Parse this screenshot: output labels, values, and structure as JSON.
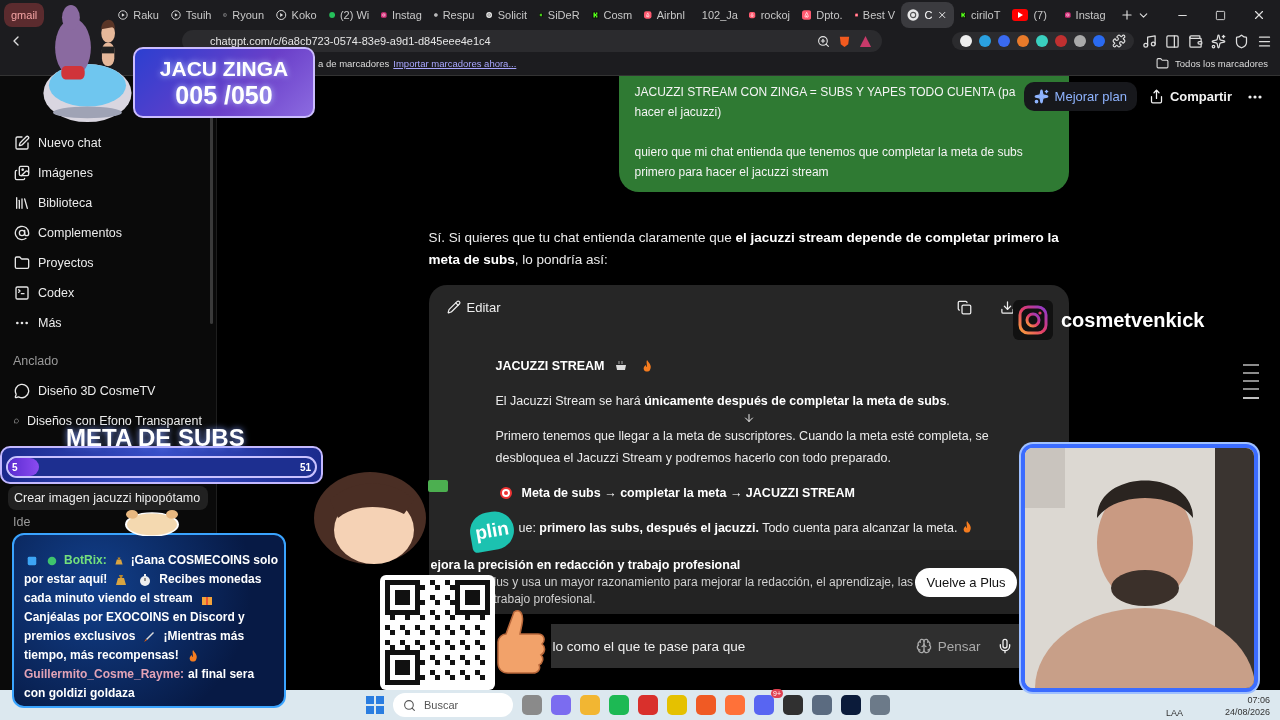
{
  "browser": {
    "tabs": [
      {
        "kind": "gmail",
        "label": "gmail",
        "selected": false
      },
      {
        "kind": "play",
        "label": "Raku",
        "selected": false
      },
      {
        "kind": "play",
        "label": "Tsuih",
        "selected": false
      },
      {
        "kind": "play",
        "label": "Ryoun",
        "selected": false
      },
      {
        "kind": "play",
        "label": "Koko",
        "selected": false
      },
      {
        "kind": "chat-app",
        "label": "(2) Wi",
        "selected": false
      },
      {
        "kind": "camera",
        "label": "Instag",
        "selected": false
      },
      {
        "kind": "assistant",
        "label": "Respu",
        "selected": false
      },
      {
        "kind": "assistant",
        "label": "Solicit",
        "selected": false
      },
      {
        "kind": "stream",
        "label": "SiDeR",
        "selected": false
      },
      {
        "kind": "stream",
        "label": "Cosm",
        "selected": false
      },
      {
        "kind": "rental",
        "label": "Airbnl",
        "selected": false
      },
      {
        "kind": "rental",
        "label": "102_Ja",
        "selected": false
      },
      {
        "kind": "rental",
        "label": "rockoj",
        "selected": false
      },
      {
        "kind": "rental",
        "label": "Dpto.",
        "selected": false
      },
      {
        "kind": "rental",
        "label": "Best V",
        "selected": false
      },
      {
        "kind": "assistant",
        "label": "C",
        "selected": true
      },
      {
        "kind": "stream",
        "label": "ciriloT",
        "selected": false
      },
      {
        "kind": "video",
        "label": "(7)",
        "selected": false
      },
      {
        "kind": "camera",
        "label": "Instag",
        "selected": false
      }
    ],
    "url": "chatgpt.com/c/6a8cb723-0574-83e9-a9d1-d845eee4e1c4"
  },
  "bookmarks_bar": {
    "text": "a de marcadores",
    "link": "Importar marcadores ahora...",
    "all_bookmarks": "Todos los marcadores"
  },
  "sidebar": {
    "items": [
      {
        "kind": "new",
        "label": "Nuevo chat"
      },
      {
        "kind": "images",
        "label": "Imágenes"
      },
      {
        "kind": "library",
        "label": "Biblioteca"
      },
      {
        "kind": "apps",
        "label": "Complementos"
      },
      {
        "kind": "projects",
        "label": "Proyectos"
      },
      {
        "kind": "codex",
        "label": "Codex"
      },
      {
        "kind": "more",
        "label": "Más"
      }
    ],
    "pinned_title": "Anclado",
    "pinned": [
      "Diseño 3D CosmeTV",
      "Diseños con Efono Transparent"
    ],
    "chats": [
      {
        "label": "Crear imagen jacuzzi hipopótamo",
        "selected": true
      }
    ],
    "section_title": "Ide"
  },
  "chat": {
    "header_buttons": [
      {
        "kind": "upgrade",
        "label": "Mejorar plan"
      },
      {
        "kind": "share",
        "label": "Compartir"
      }
    ],
    "user_message": [
      [
        "JACUZZI STREAM CON ZINGA = SUBS Y YAPES TODO CUENTA (pa",
        "hacer el jacuzzi)"
      ],
      [
        "quiero que mi chat entienda que tenemos que completar la meta de subs primero para hacer el jacuzzi stream"
      ]
    ],
    "intro": "Sí. Si quieres que tu chat entienda claramente que **el jacuzzi stream depende de completar primero la meta de subs**, lo pondría así:",
    "code_block": {
      "action": "Editar",
      "heading": "JACUZZI STREAM",
      "paragraphs": [
        "El Jacuzzi Stream se hará **únicamente después de completar la meta de subs**.",
        "Primero tenemos que llegar a la meta de suscriptores. Cuando la meta esté completa, se desbloquea el Jacuzzi Stream y podremos hacerlo con todo preparado.",
        "**Meta de subs → completar la meta → JACUZZI STREAM**",
        "ue: **primero las subs, después el jacuzzi.** Todo cuenta para alcanzar la meta."
      ]
    },
    "upsell": {
      "title": "ejora la precisión en redacción y trabajo profesional",
      "lines": [
        "lus y usa un mayor razonamiento para mejorar la redacción, el aprendizaje, las",
        "trabajo profesional."
      ],
      "button": "Vuelve a Plus"
    },
    "composer": {
      "value": "lo como el que te pase para que",
      "mode": "Pensar"
    }
  },
  "taskbar": {
    "search_placeholder": "Buscar",
    "apps": [
      {
        "color": "#8a8a8a"
      },
      {
        "color": "#7b6cf0"
      },
      {
        "color": "#f2b632"
      },
      {
        "color": "#1db954"
      },
      {
        "color": "#d9302c"
      },
      {
        "color": "#e5c100"
      },
      {
        "color": "#f05a24"
      },
      {
        "color": "#ff7139"
      },
      {
        "color": "#5865f2",
        "badge": "9+"
      },
      {
        "color": "#303030"
      },
      {
        "color": "#5b6b80"
      },
      {
        "color": "#0b1b3a"
      },
      {
        "color": "#6c7a89"
      }
    ],
    "language": "LAA",
    "time": "07:06",
    "date": "24/08/2026"
  },
  "stream_overlay": {
    "goal_banner": {
      "title": "JACU ZINGA",
      "count": "005 /050"
    },
    "sub_goal": {
      "title": "META DE SUBS",
      "start": "5",
      "end": "51",
      "level": 0.1
    },
    "chat_box": {
      "messages": [
        {
          "author": "BotRix:",
          "color": "#74e07c",
          "lines": [
            [
              "¡Gana COSMECOINS solo"
            ],
            [
              "por estar aquí!",
              "Recibes monedas"
            ],
            [
              "cada minuto viendo el stream"
            ],
            [
              "Canjéalas por EXOCOINS en Discord y"
            ],
            [
              "premios exclusivos",
              "¡Mientras más"
            ],
            [
              "tiempo, más recompensas!"
            ]
          ]
        },
        {
          "author": "Guillermito_Cosme_Rayme:",
          "color": "#e2a3b6",
          "lines": [
            [
              "al final sera"
            ],
            [
              "con goldizi goldaza"
            ]
          ]
        }
      ]
    },
    "payment_badge": "plin",
    "social": "cosmetvenkick"
  }
}
